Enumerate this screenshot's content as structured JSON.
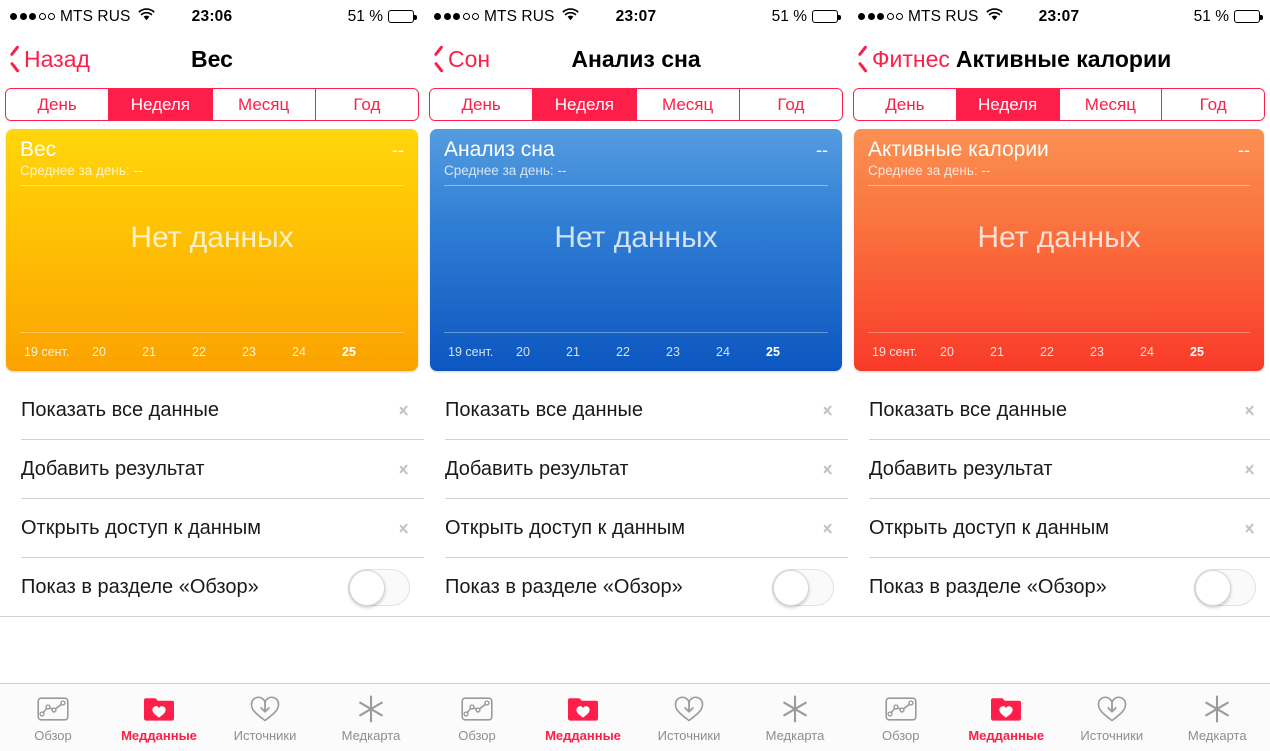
{
  "colors": {
    "accent": "#fd1f49",
    "card_yellow_top": "#ffd60b",
    "card_yellow_bottom": "#fba200",
    "card_blue_top": "#559ce0",
    "card_blue_bottom": "#0c56c0",
    "card_orange_top": "#fb9153",
    "card_orange_bottom": "#f93a29",
    "tab_inactive": "#8e8e93"
  },
  "status_bar": {
    "carrier": "MTS RUS",
    "signal_filled": 3,
    "signal_total": 5,
    "wifi_icon": "wifi-icon",
    "battery_percent": "51 %",
    "battery_level": 51,
    "time_p1": "23:06",
    "time_p2": "23:07",
    "time_p3": "23:07"
  },
  "segments": [
    "День",
    "Неделя",
    "Месяц",
    "Год"
  ],
  "active_segment": "Неделя",
  "list_rows": [
    {
      "label": "Показать все данные",
      "accessory": "chevron-right-icon"
    },
    {
      "label": "Добавить результат",
      "accessory": "chevron-right-icon"
    },
    {
      "label": "Открыть доступ к данным",
      "accessory": "chevron-right-icon"
    },
    {
      "label": "Показ в разделе «Обзор»",
      "accessory": "toggle",
      "toggle_on": false
    }
  ],
  "tabs": [
    {
      "label": "Обзор",
      "icon": "chart-box-icon",
      "active": false
    },
    {
      "label": "Медданные",
      "icon": "folder-heart-icon",
      "active": true
    },
    {
      "label": "Источники",
      "icon": "heart-download-icon",
      "active": false
    },
    {
      "label": "Медкарта",
      "icon": "medical-asterisk-icon",
      "active": false
    }
  ],
  "axis_ticks": [
    "19 сент.",
    "20",
    "21",
    "22",
    "23",
    "24",
    "25"
  ],
  "axis_bold_tick": "25",
  "panels": [
    {
      "back_label": "Назад",
      "title": "Вес",
      "title_centered": true,
      "card": {
        "title": "Вес",
        "value": "--",
        "subtitle": "Среднее за день: --",
        "empty_text": "Нет данных",
        "theme": "yellow"
      }
    },
    {
      "back_label": "Сон",
      "title": "Анализ сна",
      "title_centered": true,
      "card": {
        "title": "Анализ сна",
        "value": "--",
        "subtitle": "Среднее за день: --",
        "empty_text": "Нет данных",
        "theme": "blue"
      }
    },
    {
      "back_label": "Фитнес",
      "title": "Активные калории",
      "title_centered": false,
      "card": {
        "title": "Активные калории",
        "value": "--",
        "subtitle": "Среднее за день: --",
        "empty_text": "Нет данных",
        "theme": "orange"
      }
    }
  ],
  "chart_data": [
    {
      "type": "line",
      "title": "Вес",
      "subtitle": "Среднее за день: --",
      "value": "--",
      "categories": [
        "19 сент.",
        "20",
        "21",
        "22",
        "23",
        "24",
        "25"
      ],
      "values": [
        null,
        null,
        null,
        null,
        null,
        null,
        null
      ],
      "empty_state": "Нет данных",
      "xlabel": "",
      "ylabel": "",
      "grid": false,
      "legend": "none"
    },
    {
      "type": "line",
      "title": "Анализ сна",
      "subtitle": "Среднее за день: --",
      "value": "--",
      "categories": [
        "19 сент.",
        "20",
        "21",
        "22",
        "23",
        "24",
        "25"
      ],
      "values": [
        null,
        null,
        null,
        null,
        null,
        null,
        null
      ],
      "empty_state": "Нет данных",
      "xlabel": "",
      "ylabel": "",
      "grid": false,
      "legend": "none"
    },
    {
      "type": "line",
      "title": "Активные калории",
      "subtitle": "Среднее за день: --",
      "value": "--",
      "categories": [
        "19 сент.",
        "20",
        "21",
        "22",
        "23",
        "24",
        "25"
      ],
      "values": [
        null,
        null,
        null,
        null,
        null,
        null,
        null
      ],
      "empty_state": "Нет данных",
      "xlabel": "",
      "ylabel": "",
      "grid": false,
      "legend": "none"
    }
  ]
}
